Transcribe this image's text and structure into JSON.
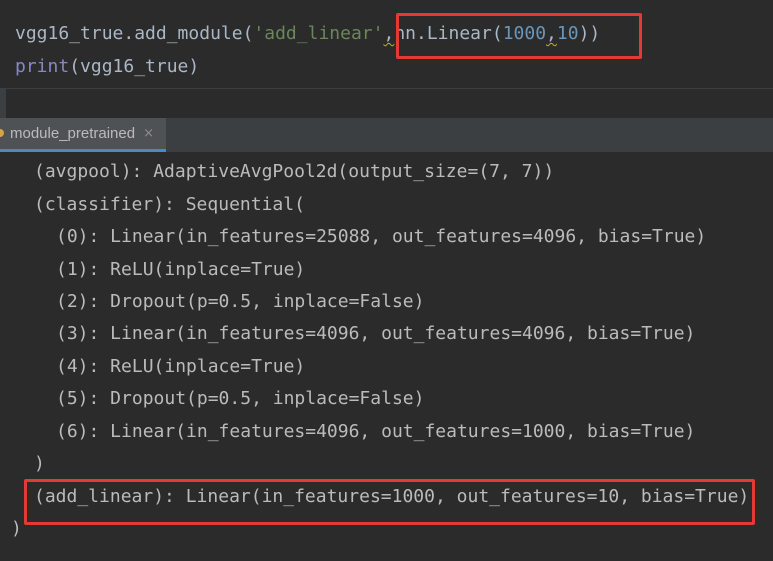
{
  "editor": {
    "line1": {
      "prefix": "vgg16_true.add_module(",
      "string_arg": "'add_linear'",
      "comma": ",",
      "call_prefix": "nn.Linear(",
      "num1": "1000",
      "sep": ",",
      "num2": "10",
      "close": "))"
    },
    "line2": {
      "builtin": "print",
      "args": "(vgg16_true)"
    }
  },
  "console_tab": {
    "label": "module_pretrained",
    "close_glyph": "×",
    "icon": "run-config-icon"
  },
  "console": {
    "lines": [
      "(avgpool): AdaptiveAvgPool2d(output_size=(7, 7))",
      "(classifier): Sequential(",
      "(0): Linear(in_features=25088, out_features=4096, bias=True)",
      "(1): ReLU(inplace=True)",
      "(2): Dropout(p=0.5, inplace=False)",
      "(3): Linear(in_features=4096, out_features=4096, bias=True)",
      "(4): ReLU(inplace=True)",
      "(5): Dropout(p=0.5, inplace=False)",
      "(6): Linear(in_features=4096, out_features=1000, bias=True)",
      ")",
      "(add_linear): Linear(in_features=1000, out_features=10, bias=True)",
      ")"
    ]
  },
  "colors": {
    "background": "#2b2b2b",
    "highlight": "#e53935",
    "string": "#6a8759",
    "number": "#6897bb",
    "builtin": "#8888c6"
  }
}
